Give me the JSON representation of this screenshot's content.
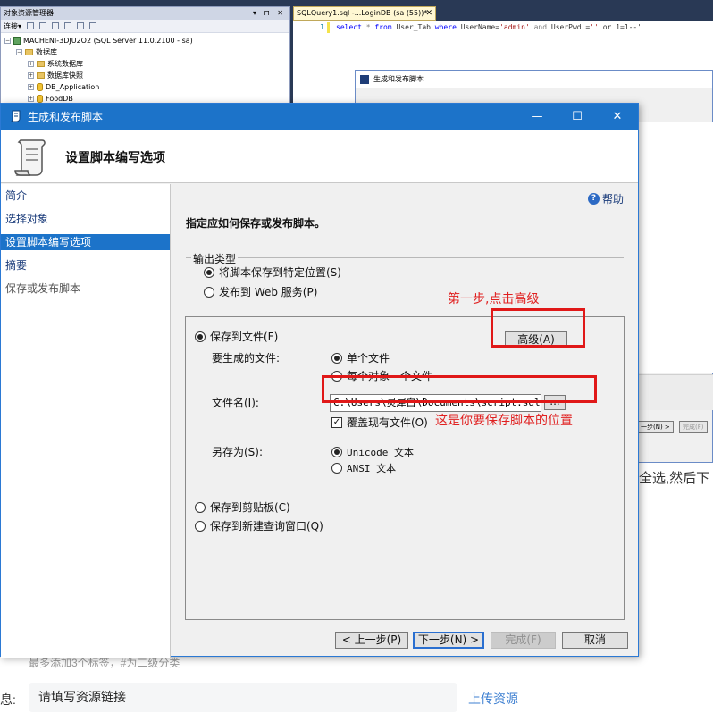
{
  "ssms": {
    "object_explorer_title": "对象资源管理器",
    "toolbar_connect": "连接▾",
    "tree": [
      {
        "label": "MACHENI-3DJU2O2 (SQL Server 11.0.2100 - sa)",
        "indent": 0,
        "icon": "server-icon"
      },
      {
        "label": "数据库",
        "indent": 1,
        "icon": "folder-icon"
      },
      {
        "label": "系统数据库",
        "indent": 2,
        "icon": "folder-icon"
      },
      {
        "label": "数据库快照",
        "indent": 2,
        "icon": "folder-icon"
      },
      {
        "label": "DB_Application",
        "indent": 2,
        "icon": "database-icon"
      },
      {
        "label": "FoodDB",
        "indent": 2,
        "icon": "database-icon"
      }
    ],
    "query_tab": "SQLQuery1.sql -...LoginDB (sa (55))*",
    "query_tab_close": "✕",
    "code_line_number": "1",
    "code": {
      "t1": "select",
      "t2": " * ",
      "t3": "from",
      "t4": " User_Tab ",
      "t5": "where",
      "t6": " UserName=",
      "t7": "'admin'",
      "t8": " and ",
      "t9": "UserPwd =",
      "t10": "''",
      "t11": " or 1=1--'"
    }
  },
  "bg_dialog": {
    "title": "生成和发布脚本",
    "nav_buttons": [
      "一步(N) >",
      "完成(F)"
    ]
  },
  "web": {
    "hint_right": "全选,然后下",
    "tag_hint": "最多添加3个标签，#为二级分类",
    "resource_label": "息:",
    "resource_placeholder": "请填写资源链接",
    "upload_link": "上传资源"
  },
  "dialog": {
    "title": "生成和发布脚本",
    "header_title": "设置脚本编写选项",
    "window_buttons": {
      "minimize": "—",
      "maximize": "☐",
      "close": "✕"
    },
    "nav": [
      {
        "label": "简介",
        "state": "normal"
      },
      {
        "label": "选择对象",
        "state": "normal"
      },
      {
        "label": "设置脚本编写选项",
        "state": "selected"
      },
      {
        "label": "摘要",
        "state": "normal"
      },
      {
        "label": "保存或发布脚本",
        "state": "dim"
      }
    ],
    "help_label": "帮助",
    "instruction": "指定应如何保存或发布脚本。",
    "output_type": {
      "legend": "输出类型",
      "options": [
        {
          "label": "将脚本保存到特定位置(S)",
          "selected": true
        },
        {
          "label": "发布到 Web 服务(P)",
          "selected": false
        }
      ]
    },
    "save_to_file": {
      "label": "保存到文件(F)",
      "selected": true,
      "advanced_button": "高级(A)",
      "files_to_generate_label": "要生成的文件:",
      "files_options": [
        {
          "label": "单个文件",
          "selected": true
        },
        {
          "label": "每个对象一个文件",
          "selected": false
        }
      ],
      "file_name_label": "文件名(I):",
      "file_name_value": "C:\\Users\\灵犀白\\Documents\\script.sql",
      "browse_button": "...",
      "overwrite_label": "覆盖现有文件(O)",
      "overwrite_checked": true,
      "save_as_label": "另存为(S):",
      "encoding_options": [
        {
          "label": "Unicode 文本",
          "selected": true
        },
        {
          "label": "ANSI 文本",
          "selected": false
        }
      ]
    },
    "save_to_clipboard": {
      "label": "保存到剪贴板(C)",
      "selected": false
    },
    "save_to_query_window": {
      "label": "保存到新建查询窗口(Q)",
      "selected": false
    },
    "buttons": {
      "back": "< 上一步(P)",
      "next": "下一步(N) >",
      "finish": "完成(F)",
      "cancel": "取消"
    }
  },
  "annotations": {
    "step1": "第一步,点击高级",
    "location": "这是你要保存脚本的位置",
    "color": "#e01818"
  }
}
